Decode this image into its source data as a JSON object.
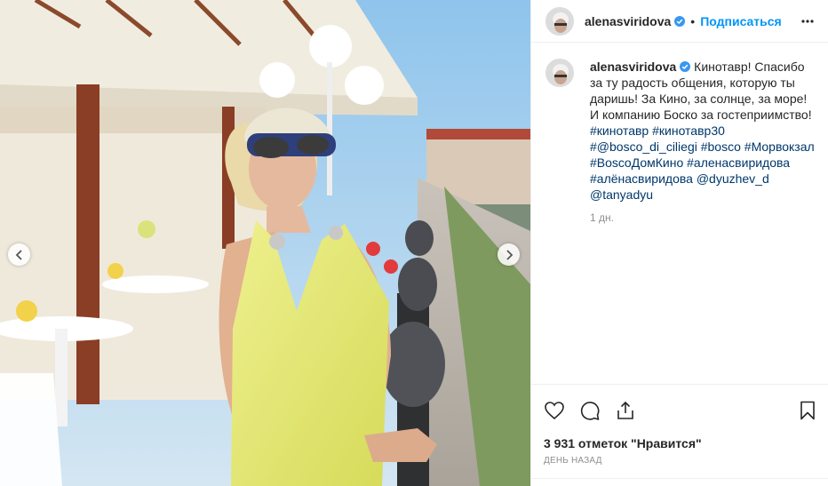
{
  "post": {
    "image_description": "photo",
    "prev_icon": "chevron-left-icon",
    "next_icon": "chevron-right-icon"
  },
  "header": {
    "username": "alenasviridova",
    "separator": "•",
    "follow_label": "Подписаться",
    "more_icon": "more-horizontal-icon"
  },
  "caption": {
    "username": "alenasviridova",
    "text": "Кинотавр! Спасибо за ту радость общения, которую ты даришь! За Кино, за солнце, за море! И компанию Боско за гостеприимство!",
    "hashtags": [
      "#кинотавр",
      "#кинотавр30",
      "#@bosco_di_ciliegi",
      "#bosco",
      "#Морвокзал",
      "#BoscoДомКино",
      "#аленасвиридова",
      "#алёнасвиридова"
    ],
    "mentions": [
      "@dyuzhev_d",
      "@tanyadyu"
    ],
    "time": "1 дн."
  },
  "actions": {
    "like_icon": "heart-icon",
    "comment_icon": "comment-icon",
    "share_icon": "share-icon",
    "save_icon": "bookmark-icon"
  },
  "likes_text": "3 931 отметок \"Нравится\"",
  "date_text": "ДЕНЬ НАЗАД",
  "colors": {
    "link": "#00376b",
    "follow": "#0095f6",
    "verified": "#3897f0",
    "dress": "#e8ec7a"
  }
}
